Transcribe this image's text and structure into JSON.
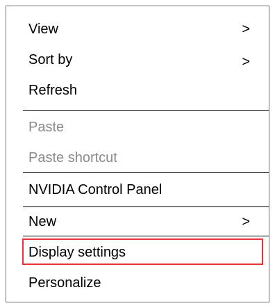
{
  "context_menu": {
    "items": [
      {
        "label": "View",
        "submenu_arrow": ">"
      },
      {
        "label": "Sort by",
        "submenu_arrow": ">"
      },
      {
        "label": "Refresh"
      },
      {
        "label": "Paste",
        "disabled": true
      },
      {
        "label": "Paste shortcut",
        "disabled": true
      },
      {
        "label": "NVIDIA Control Panel"
      },
      {
        "label": "New",
        "submenu_arrow": ">"
      },
      {
        "label": "Display settings",
        "highlighted": true
      },
      {
        "label": "Personalize"
      }
    ],
    "highlight_color": "#e8333b"
  }
}
